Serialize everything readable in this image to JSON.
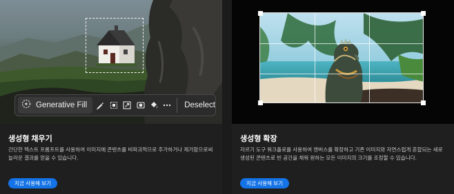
{
  "cards": [
    {
      "title": "생성형 채우기",
      "description": "간단한 텍스트 프롬프트를 사용하여 이미지에 콘텐츠를 비파괴적으로 추가하거나 제거함으로써 놀라운 결과를 얻을 수 있습니다.",
      "cta_label": "지금 사용해 보기",
      "taskbar": {
        "generative_fill_label": "Generative Fill",
        "deselect_label": "Deselect",
        "icons": [
          "generative-fill-icon",
          "brush-icon",
          "transform-icon",
          "select-subject-icon",
          "mask-icon",
          "fill-icon",
          "more-icon"
        ]
      }
    },
    {
      "title": "생성형 확장",
      "description": "자르기 도구 워크플로를 사용하여 캔버스를 확장하고 기존 이미지와 자연스럽게 혼합되는 새로 생성된 콘텐츠로 빈 공간을 채워 원하는 모든 이미지의 크기를 조정할 수 있습니다.",
      "cta_label": "지금 사용해 보기"
    }
  ],
  "colors": {
    "accent": "#1473e6",
    "card_bg": "#1f1f1f",
    "taskbar_bg": "#2c2c2c"
  }
}
